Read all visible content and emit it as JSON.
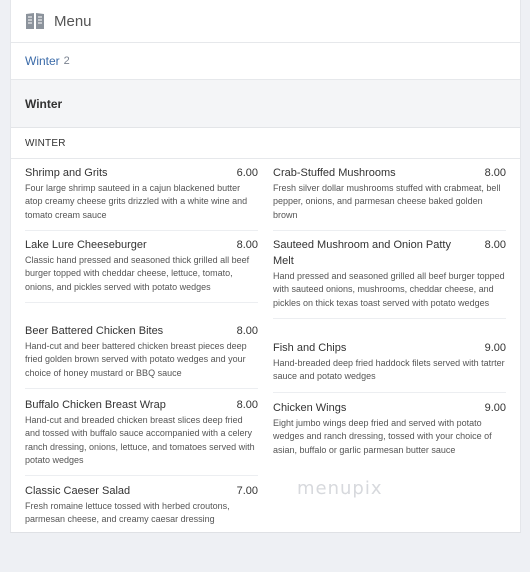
{
  "header": {
    "title": "Menu",
    "icon": "book-icon"
  },
  "tabs": [
    {
      "label": "Winter",
      "count": "2"
    }
  ],
  "section": {
    "title": "Winter",
    "subtitle": "WINTER"
  },
  "items_left": [
    {
      "name": "Shrimp and Grits",
      "price": "6.00",
      "description": "Four large shrimp sauteed in a cajun blackened butter atop creamy cheese grits drizzled with a white wine and tomato cream sauce"
    },
    {
      "name": "Lake Lure Cheeseburger",
      "price": "8.00",
      "description": "Classic hand pressed and seasoned thick grilled all beef burger topped with cheddar cheese, lettuce, tomato, onions, and pickles served with potato wedges"
    },
    {
      "name": "Beer Battered Chicken Bites",
      "price": "8.00",
      "description": "Hand-cut and beer battered chicken breast pieces deep fried golden brown served with potato wedges and your choice of honey mustard or BBQ sauce"
    },
    {
      "name": "Buffalo Chicken Breast Wrap",
      "price": "8.00",
      "description": "Hand-cut and breaded chicken breast slices deep fried and tossed with buffalo sauce accompanied with a celery ranch dressing, onions, lettuce, and tomatoes served with potato wedges"
    },
    {
      "name": "Classic Caeser Salad",
      "price": "7.00",
      "description": "Fresh romaine lettuce tossed with herbed croutons, parmesan cheese, and creamy caesar dressing"
    }
  ],
  "items_right": [
    {
      "name": "Crab-Stuffed Mushrooms",
      "price": "8.00",
      "description": "Fresh silver dollar mushrooms stuffed with crabmeat, bell pepper, onions, and parmesan cheese baked golden brown"
    },
    {
      "name": "Sauteed Mushroom and Onion Patty Melt",
      "price": "8.00",
      "description": "Hand pressed and seasoned grilled all beef burger topped with sauteed onions, mushrooms, cheddar cheese, and pickles on thick texas toast served with potato wedges"
    },
    {
      "name": "Fish and Chips",
      "price": "9.00",
      "description": "Hand-breaded deep fried haddock filets served with tatrter sauce and potato wedges"
    },
    {
      "name": "Chicken Wings",
      "price": "9.00",
      "description": "Eight jumbo wings deep fried and served with potato wedges and ranch dressing, tossed with your choice of asian, buffalo or garlic parmesan butter sauce"
    }
  ],
  "watermark": "menupix"
}
